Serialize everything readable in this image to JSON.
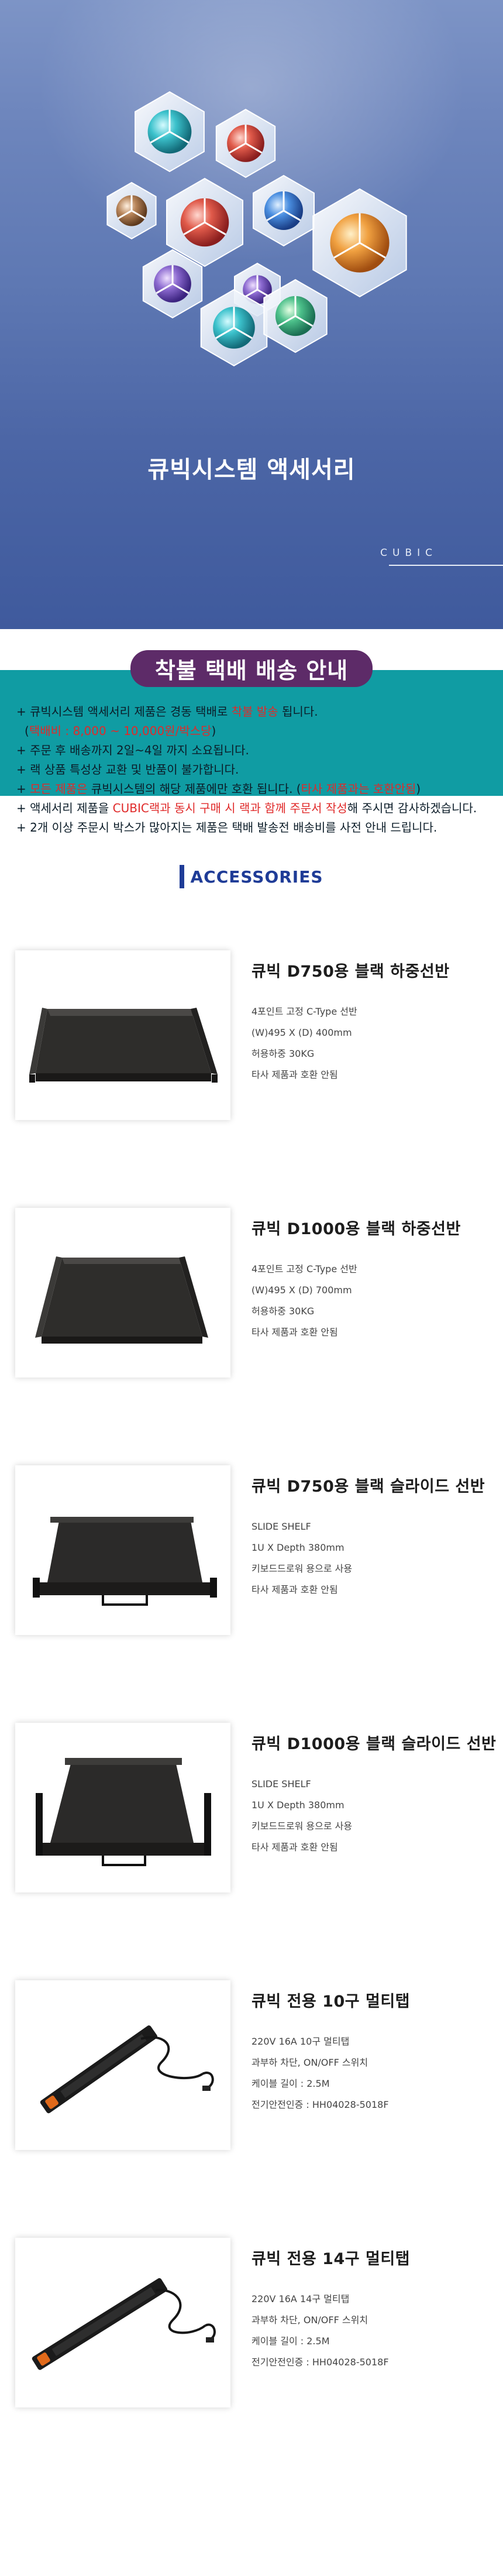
{
  "hero": {
    "title": "큐빅시스템 액세서리",
    "brand_label": "CUBIC",
    "colors": {
      "top": "#7d94c6",
      "bottom": "#3f5a9d"
    }
  },
  "notice": {
    "title": "착불 택배 배송 안내",
    "bg_color": "#109ca3",
    "title_bg": "#5d2b68",
    "lines": [
      {
        "a": " + 큐빅시스템 액세서리 제품은 경동 택배로 ",
        "red": "착불 발송",
        "b": " 됩니다."
      },
      {
        "a": "  (",
        "red": "택배비 : 8,000 ~ 10,000원/박스당",
        "b": ")"
      },
      {
        "a": "+ 주문 후 배송까지 2일~4일 까지 소요됩니다.",
        "red": "",
        "b": ""
      },
      {
        "a": "+ 랙 상품 특성상 교환 및 반품이 불가합니다.",
        "red": "",
        "b": ""
      },
      {
        "a": "+ ",
        "red": "모든 제품은",
        "b": " 큐빅시스템의 해당 제품에만 호환 됩니다. (",
        "red2": "타사 제품과는 호환안됨",
        "c": ")"
      },
      {
        "a": "+ 액세서리 제품을 ",
        "red": "CUBIC랙과 동시 구매 시 랙과 함께 주문서 작성",
        "b": "해 주시면 감사하겠습니다.",
        "hidden_tail": true
      },
      {
        "a": "+ 2개 이상 주문시 박스가 많아지는 제품은 택배 발송전 배송비를 사전 안내 드립니다.",
        "red": "",
        "b": ""
      }
    ]
  },
  "accessories_heading": "ACCESSORIES",
  "products": [
    {
      "name": "큐빅 D750용 블랙 하중선반",
      "icon": "shelf-tray-image",
      "specs": [
        "4포인트 고정 C-Type 선반",
        "(W)495 X (D) 400mm",
        "허용하중 30KG",
        "타사 제품과 호환 안됨"
      ]
    },
    {
      "name": "큐빅 D1000용 블랙 하중선반",
      "icon": "shelf-tray-image",
      "specs": [
        "4포인트 고정 C-Type 선반",
        "(W)495 X (D) 700mm",
        "허용하중 30KG",
        "타사 제품과 호환 안됨"
      ]
    },
    {
      "name": "큐빅 D750용 블랙 슬라이드 선반",
      "icon": "slide-shelf-image",
      "specs": [
        "SLIDE SHELF",
        "1U X Depth 380mm",
        "키보드드로워 용으로 사용",
        "타사 제품과 호환 안됨"
      ]
    },
    {
      "name": "큐빅 D1000용 블랙 슬라이드 선반",
      "icon": "slide-shelf-image",
      "specs": [
        "SLIDE SHELF",
        "1U X Depth 380mm",
        "키보드드로워 용으로 사용",
        "타사 제품과 호환 안됨"
      ]
    },
    {
      "name": "큐빅 전용 10구 멀티탭",
      "icon": "power-strip-image",
      "specs": [
        "220V 16A 10구 멀티탭",
        "과부하 차단, ON/OFF 스위치",
        "케이블 길이 : 2.5M",
        "전기안전인증 : HH04028-5018F"
      ]
    },
    {
      "name": "큐빅 전용 14구 멀티탭",
      "icon": "power-strip-image",
      "specs": [
        "220V 16A 14구 멀티탭",
        "과부하 차단, ON/OFF 스위치",
        "케이블 길이 : 2.5M",
        "전기안전인증 : HH04028-5018F"
      ]
    }
  ]
}
